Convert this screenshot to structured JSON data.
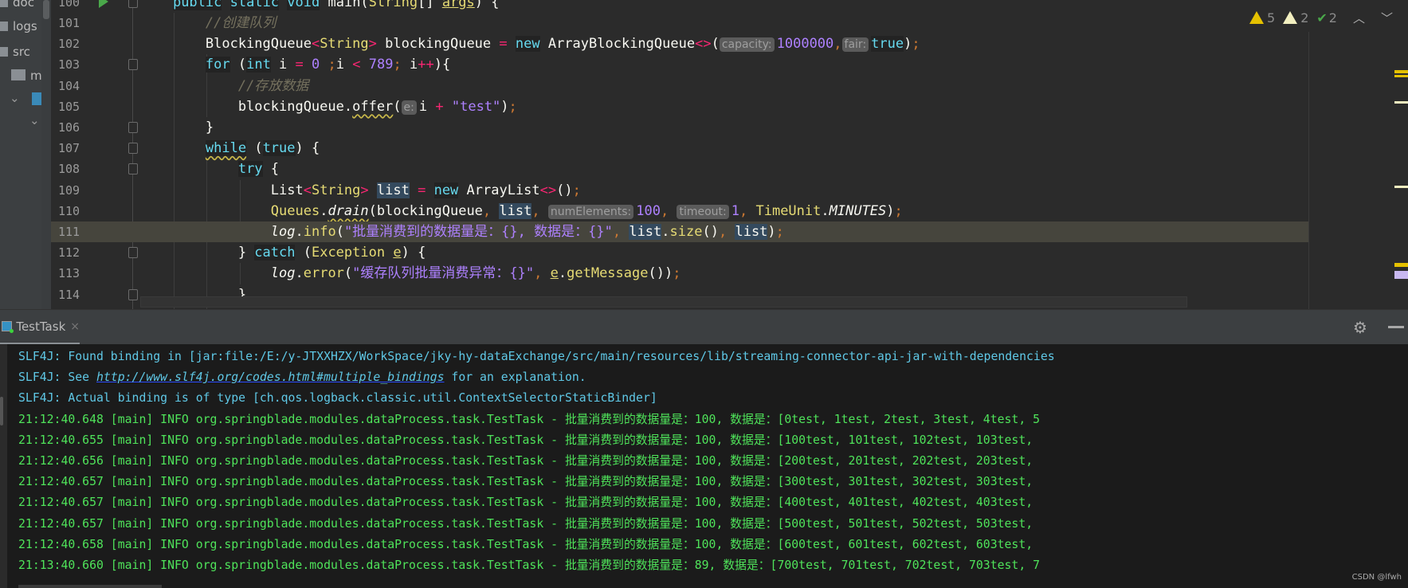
{
  "project_panel": {
    "items": [
      {
        "label": "doc",
        "type": "folder"
      },
      {
        "label": "logs",
        "type": "folder"
      },
      {
        "label": "src",
        "type": "folder"
      },
      {
        "label": "mai",
        "type": "folder"
      }
    ]
  },
  "editor": {
    "current_line": 111,
    "lines": [
      {
        "n": 100,
        "fold": true,
        "tokens": [
          {
            "t": "    "
          },
          {
            "t": "public",
            "k": "kw"
          },
          {
            "t": " "
          },
          {
            "t": "static",
            "k": "kw"
          },
          {
            "t": " "
          },
          {
            "t": "void",
            "k": "kw"
          },
          {
            "t": " main("
          },
          {
            "t": "String",
            "k": "ty"
          },
          {
            "t": "[] "
          },
          {
            "t": "args",
            "k": "ul"
          },
          {
            "t": ") {"
          }
        ]
      },
      {
        "n": 101,
        "tokens": [
          {
            "t": "        "
          },
          {
            "t": "//创建队列",
            "k": "cm"
          }
        ]
      },
      {
        "n": 102,
        "tokens": [
          {
            "t": "        BlockingQueue"
          },
          {
            "t": "<",
            "k": "op"
          },
          {
            "t": "String",
            "k": "ty"
          },
          {
            "t": ">",
            "k": "op"
          },
          {
            "t": " blockingQueue "
          },
          {
            "t": "=",
            "k": "op"
          },
          {
            "t": " "
          },
          {
            "t": "new",
            "k": "kw"
          },
          {
            "t": " ArrayBlockingQueue"
          },
          {
            "t": "<>",
            "k": "op"
          },
          {
            "t": "("
          },
          {
            "t": "capacity:",
            "k": "hint"
          },
          {
            "t": "1000000",
            "k": "num"
          },
          {
            "t": ",",
            "k": "semi"
          },
          {
            "t": "fair:",
            "k": "hint"
          },
          {
            "t": "true",
            "k": "kw"
          },
          {
            "t": ")"
          },
          {
            "t": ";",
            "k": "semi"
          }
        ]
      },
      {
        "n": 103,
        "fold": true,
        "tokens": [
          {
            "t": "        "
          },
          {
            "t": "for",
            "k": "kw"
          },
          {
            "t": " ("
          },
          {
            "t": "int",
            "k": "kw"
          },
          {
            "t": " i "
          },
          {
            "t": "=",
            "k": "op"
          },
          {
            "t": " "
          },
          {
            "t": "0",
            "k": "num"
          },
          {
            "t": " "
          },
          {
            "t": ";",
            "k": "semi"
          },
          {
            "t": "i "
          },
          {
            "t": "<",
            "k": "op"
          },
          {
            "t": " "
          },
          {
            "t": "789",
            "k": "num"
          },
          {
            "t": ";",
            "k": "semi"
          },
          {
            "t": " i"
          },
          {
            "t": "++",
            "k": "op"
          },
          {
            "t": "){"
          }
        ]
      },
      {
        "n": 104,
        "tokens": [
          {
            "t": "            "
          },
          {
            "t": "//存放数据",
            "k": "cm"
          }
        ]
      },
      {
        "n": 105,
        "tokens": [
          {
            "t": "            blockingQueue."
          },
          {
            "t": "offer",
            "k": "wavy"
          },
          {
            "t": "("
          },
          {
            "t": "e:",
            "k": "hint"
          },
          {
            "t": "i "
          },
          {
            "t": "+",
            "k": "op"
          },
          {
            "t": " "
          },
          {
            "t": "\"test\"",
            "k": "str"
          },
          {
            "t": ")"
          },
          {
            "t": ";",
            "k": "semi"
          }
        ]
      },
      {
        "n": 106,
        "fold": true,
        "tokens": [
          {
            "t": "        }"
          }
        ]
      },
      {
        "n": 107,
        "fold": true,
        "tokens": [
          {
            "t": "        "
          },
          {
            "t": "while",
            "k": "kw wavy"
          },
          {
            "t": " ("
          },
          {
            "t": "true",
            "k": "kw"
          },
          {
            "t": ") {"
          }
        ]
      },
      {
        "n": 108,
        "fold": true,
        "tokens": [
          {
            "t": "            "
          },
          {
            "t": "try",
            "k": "kw"
          },
          {
            "t": " {"
          }
        ]
      },
      {
        "n": 109,
        "tokens": [
          {
            "t": "                List"
          },
          {
            "t": "<",
            "k": "op"
          },
          {
            "t": "String",
            "k": "ty"
          },
          {
            "t": ">",
            "k": "op"
          },
          {
            "t": " "
          },
          {
            "t": "list",
            "k": "hl"
          },
          {
            "t": " "
          },
          {
            "t": "=",
            "k": "op"
          },
          {
            "t": " "
          },
          {
            "t": "new",
            "k": "kw"
          },
          {
            "t": " ArrayList"
          },
          {
            "t": "<>",
            "k": "op"
          },
          {
            "t": "()"
          },
          {
            "t": ";",
            "k": "semi"
          }
        ]
      },
      {
        "n": 110,
        "tokens": [
          {
            "t": "                "
          },
          {
            "t": "Queues",
            "k": "ty"
          },
          {
            "t": "."
          },
          {
            "t": "drain",
            "k": "it wavy"
          },
          {
            "t": "(blockingQueue"
          },
          {
            "t": ",",
            "k": "semi"
          },
          {
            "t": " "
          },
          {
            "t": "list",
            "k": "hl"
          },
          {
            "t": ",",
            "k": "semi"
          },
          {
            "t": " "
          },
          {
            "t": "numElements:",
            "k": "hint"
          },
          {
            "t": "100",
            "k": "num"
          },
          {
            "t": ",",
            "k": "semi"
          },
          {
            "t": " "
          },
          {
            "t": "timeout:",
            "k": "hint"
          },
          {
            "t": "1",
            "k": "num"
          },
          {
            "t": ",",
            "k": "semi"
          },
          {
            "t": " "
          },
          {
            "t": "TimeUnit",
            "k": "ty"
          },
          {
            "t": "."
          },
          {
            "t": "MINUTES",
            "k": "it"
          },
          {
            "t": ")"
          },
          {
            "t": ";",
            "k": "semi"
          }
        ]
      },
      {
        "n": 111,
        "tokens": [
          {
            "t": "                "
          },
          {
            "t": "log",
            "k": "it"
          },
          {
            "t": "."
          },
          {
            "t": "info",
            "k": "ty"
          },
          {
            "t": "("
          },
          {
            "t": "\"批量消费到的数据量是：{}, 数据是：{}\"",
            "k": "str"
          },
          {
            "t": ",",
            "k": "semi"
          },
          {
            "t": " "
          },
          {
            "t": "list",
            "k": "hl"
          },
          {
            "t": "."
          },
          {
            "t": "size",
            "k": "ty"
          },
          {
            "t": "()"
          },
          {
            "t": ",",
            "k": "semi"
          },
          {
            "t": " "
          },
          {
            "t": "list",
            "k": "hl"
          },
          {
            "t": ")"
          },
          {
            "t": ";",
            "k": "semi"
          }
        ]
      },
      {
        "n": 112,
        "fold": true,
        "tokens": [
          {
            "t": "            } "
          },
          {
            "t": "catch",
            "k": "kw"
          },
          {
            "t": " ("
          },
          {
            "t": "Exception",
            "k": "ty"
          },
          {
            "t": " "
          },
          {
            "t": "e",
            "k": "ul"
          },
          {
            "t": ") {"
          }
        ]
      },
      {
        "n": 113,
        "tokens": [
          {
            "t": "                "
          },
          {
            "t": "log",
            "k": "it"
          },
          {
            "t": "."
          },
          {
            "t": "error",
            "k": "ty"
          },
          {
            "t": "("
          },
          {
            "t": "\"缓存队列批量消费异常：{}\"",
            "k": "str"
          },
          {
            "t": ",",
            "k": "semi"
          },
          {
            "t": " "
          },
          {
            "t": "e",
            "k": "ul"
          },
          {
            "t": "."
          },
          {
            "t": "getMessage",
            "k": "ty"
          },
          {
            "t": "())"
          },
          {
            "t": ";",
            "k": "semi"
          }
        ]
      },
      {
        "n": 114,
        "fold": true,
        "tokens": [
          {
            "t": "            }"
          }
        ]
      }
    ]
  },
  "inspections": {
    "warnings": "5",
    "weak_warnings": "2",
    "typos": "2"
  },
  "run_panel": {
    "tab_label": "TestTask",
    "tab_close": "×",
    "gear_icon": "⚙"
  },
  "console": {
    "lines": [
      [
        {
          "t": "SLF4J: Found binding in [jar:file:/E:/y-JTXXHZX/WorkSpace/jky-hy-dataExchange/src/main/resources/lib/streaming-connector-api-jar-with-dependencies",
          "k": "sys"
        }
      ],
      [
        {
          "t": "SLF4J: See ",
          "k": "sys"
        },
        {
          "t": "http://www.slf4j.org/codes.html#multiple_bindings",
          "k": "link"
        },
        {
          "t": " for an explanation.",
          "k": "sys"
        }
      ],
      [
        {
          "t": "SLF4J: Actual binding is of type [ch.qos.logback.classic.util.ContextSelectorStaticBinder]",
          "k": "sys"
        }
      ],
      [
        {
          "t": "21:12:40.648 [main] INFO org.springblade.modules.dataProcess.task.TestTask - 批量消费到的数据量是：100, 数据是：[0test, 1test, 2test, 3test, 4test, 5",
          "k": "info"
        }
      ],
      [
        {
          "t": "21:12:40.655 [main] INFO org.springblade.modules.dataProcess.task.TestTask - 批量消费到的数据量是：100, 数据是：[100test, 101test, 102test, 103test,",
          "k": "info"
        }
      ],
      [
        {
          "t": "21:12:40.656 [main] INFO org.springblade.modules.dataProcess.task.TestTask - 批量消费到的数据量是：100, 数据是：[200test, 201test, 202test, 203test,",
          "k": "info"
        }
      ],
      [
        {
          "t": "21:12:40.657 [main] INFO org.springblade.modules.dataProcess.task.TestTask - 批量消费到的数据量是：100, 数据是：[300test, 301test, 302test, 303test,",
          "k": "info"
        }
      ],
      [
        {
          "t": "21:12:40.657 [main] INFO org.springblade.modules.dataProcess.task.TestTask - 批量消费到的数据量是：100, 数据是：[400test, 401test, 402test, 403test,",
          "k": "info"
        }
      ],
      [
        {
          "t": "21:12:40.657 [main] INFO org.springblade.modules.dataProcess.task.TestTask - 批量消费到的数据量是：100, 数据是：[500test, 501test, 502test, 503test,",
          "k": "info"
        }
      ],
      [
        {
          "t": "21:12:40.658 [main] INFO org.springblade.modules.dataProcess.task.TestTask - 批量消费到的数据量是：100, 数据是：[600test, 601test, 602test, 603test,",
          "k": "info"
        }
      ],
      [
        {
          "t": "21:13:40.660 [main] INFO org.springblade.modules.dataProcess.task.TestTask - 批量消费到的数据量是：89, 数据是：[700test, 701test, 702test, 703test, 7",
          "k": "info"
        }
      ]
    ]
  },
  "watermark": "CSDN @lfwh",
  "colors": {
    "keyword": "#66d9ef",
    "type": "#e6db74",
    "operator": "#f92672",
    "number": "#ae81ff",
    "console_info": "#4fe35a",
    "console_sys": "#5fc8e6",
    "current_line": "#46453d"
  }
}
